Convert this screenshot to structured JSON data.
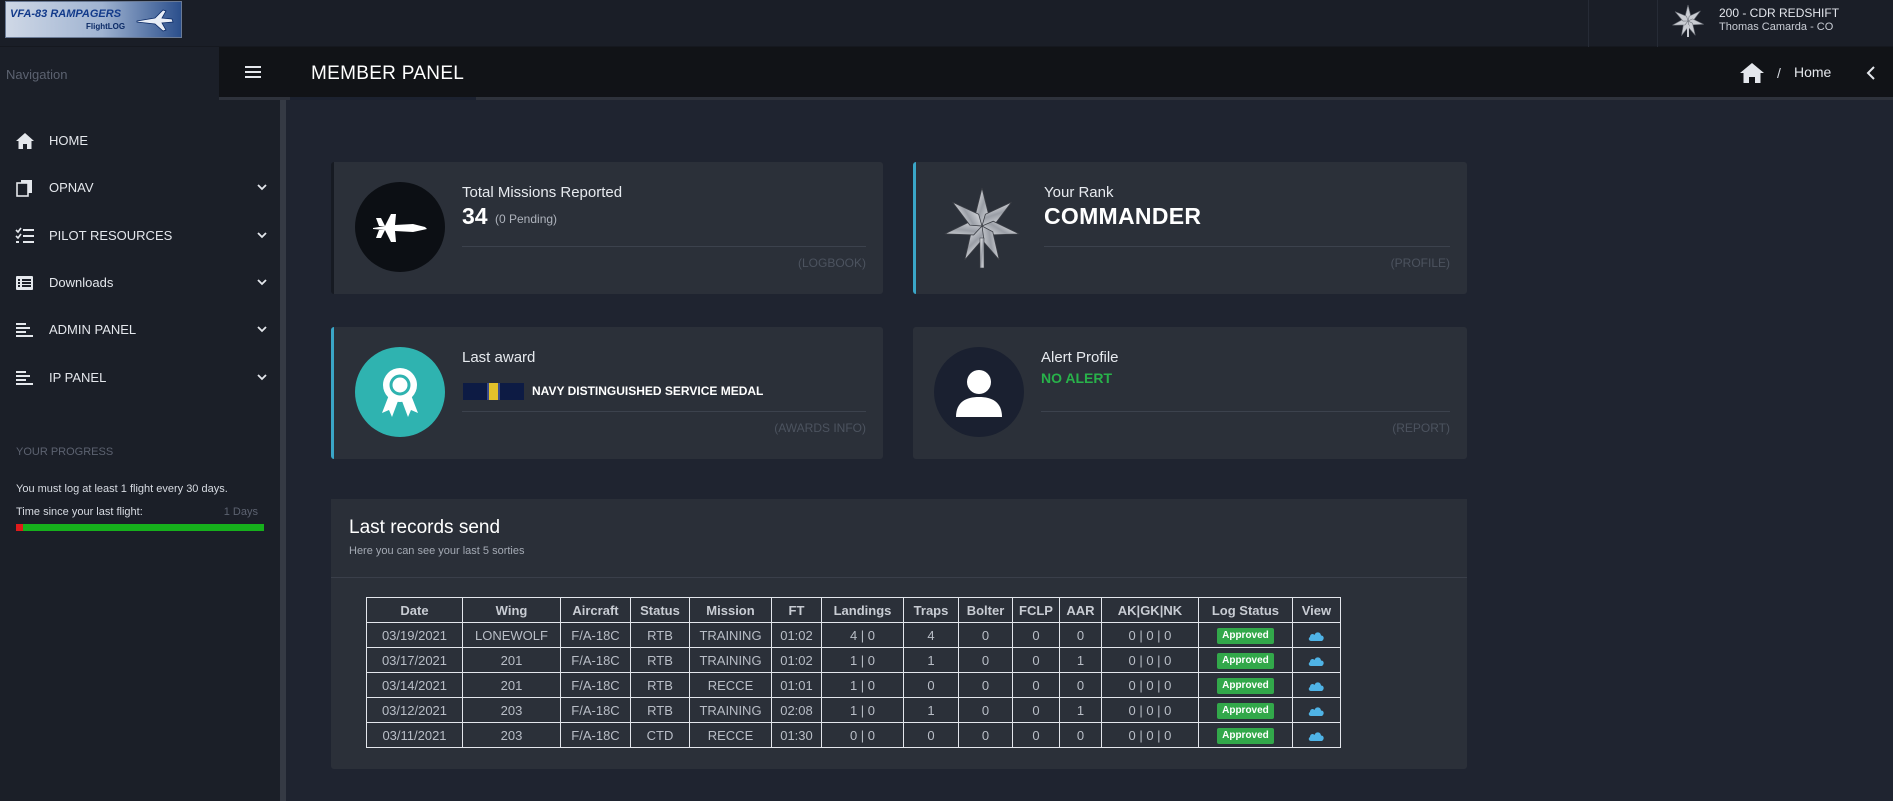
{
  "colors": {
    "accent": "#3aa6c7",
    "approved": "#32a84a",
    "no_alert": "#28b24a",
    "progress_fill": "#16b01c",
    "progress_start": "#e01b1b"
  },
  "topbar": {
    "logo_text": "VFA-83 RAMPAGERS",
    "logo_sub": "FlightLOG",
    "user_name": "200 - CDR REDSHIFT",
    "user_sub": "Thomas Camarda - CO"
  },
  "sidebar": {
    "nav_label": "Navigation",
    "items": [
      {
        "label": "HOME",
        "icon": "home-icon",
        "has_submenu": false
      },
      {
        "label": "OPNAV",
        "icon": "documents-icon",
        "has_submenu": true
      },
      {
        "label": "PILOT RESOURCES",
        "icon": "checklist-icon",
        "has_submenu": true
      },
      {
        "label": "Downloads",
        "icon": "list-box-icon",
        "has_submenu": true
      },
      {
        "label": "ADMIN PANEL",
        "icon": "align-left-icon",
        "has_submenu": true
      },
      {
        "label": "IP PANEL",
        "icon": "align-left-icon",
        "has_submenu": true
      }
    ],
    "progress": {
      "title": "YOUR PROGRESS",
      "note": "You must log at least 1 flight every 30 days.",
      "since_label": "Time since your last flight:",
      "days": "1 Days",
      "fraction": 0.033
    }
  },
  "header": {
    "title": "MEMBER PANEL",
    "breadcrumb_sep": "/",
    "breadcrumb_home": "Home"
  },
  "cards": {
    "missions": {
      "title": "Total Missions Reported",
      "count": "34",
      "pending": "(0 Pending)",
      "link": "(LOGBOOK)"
    },
    "rank": {
      "title": "Your Rank",
      "value": "COMMANDER",
      "link": "(PROFILE)"
    },
    "award": {
      "title": "Last award",
      "name": "NAVY DISTINGUISHED SERVICE MEDAL",
      "link": "(AWARDS INFO)"
    },
    "alert": {
      "title": "Alert Profile",
      "value": "NO ALERT",
      "link": "(REPORT)"
    }
  },
  "records": {
    "title": "Last records send",
    "subtitle": "Here you can see your last 5 sorties",
    "columns": [
      "Date",
      "Wing",
      "Aircraft",
      "Status",
      "Mission",
      "FT",
      "Landings",
      "Traps",
      "Bolter",
      "FCLP",
      "AAR",
      "AK|GK|NK",
      "Log Status",
      "View"
    ],
    "rows": [
      [
        "03/19/2021",
        "LONEWOLF",
        "F/A-18C",
        "RTB",
        "TRAINING",
        "01:02",
        "4 | 0",
        "4",
        "0",
        "0",
        "0",
        "0 | 0 | 0",
        "Approved"
      ],
      [
        "03/17/2021",
        "201",
        "F/A-18C",
        "RTB",
        "TRAINING",
        "01:02",
        "1 | 0",
        "1",
        "0",
        "0",
        "1",
        "0 | 0 | 0",
        "Approved"
      ],
      [
        "03/14/2021",
        "201",
        "F/A-18C",
        "RTB",
        "RECCE",
        "01:01",
        "1 | 0",
        "0",
        "0",
        "0",
        "0",
        "0 | 0 | 0",
        "Approved"
      ],
      [
        "03/12/2021",
        "203",
        "F/A-18C",
        "RTB",
        "TRAINING",
        "02:08",
        "1 | 0",
        "1",
        "0",
        "0",
        "1",
        "0 | 0 | 0",
        "Approved"
      ],
      [
        "03/11/2021",
        "203",
        "F/A-18C",
        "CTD",
        "RECCE",
        "01:30",
        "0 | 0",
        "0",
        "0",
        "0",
        "0",
        "0 | 0 | 0",
        "Approved"
      ]
    ]
  }
}
